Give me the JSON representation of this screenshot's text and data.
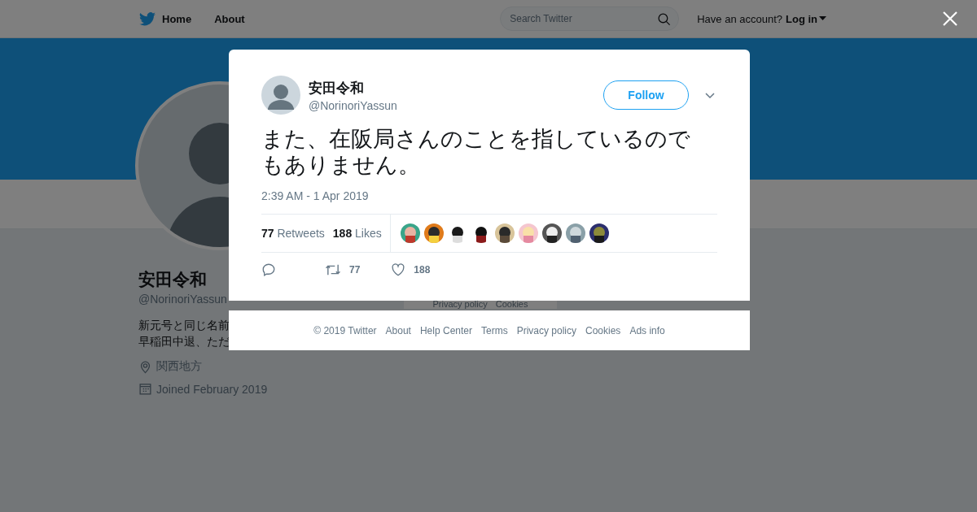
{
  "header": {
    "nav": [
      "Home",
      "About"
    ],
    "search": {
      "placeholder": "Search Twitter"
    },
    "account_prompt": "Have an account?",
    "login": "Log in"
  },
  "profile": {
    "name": "安田令和",
    "handle": "@NorinoriYassun",
    "bio_lines": [
      "新元号と同じ名前",
      "早稲田中退、ただ"
    ],
    "location": "関西地方",
    "joined": "Joined February 2019",
    "sidebar_links": [
      "Privacy policy",
      "Cookies"
    ]
  },
  "tweet": {
    "name": "安田令和",
    "handle": "@NorinoriYassun",
    "follow": "Follow",
    "text": "また、在阪局さんのことを指しているのでもありません。",
    "time": "2:39 AM - 1 Apr 2019",
    "retweets": "77",
    "retweets_label": "Retweets",
    "likes": "188",
    "likes_label": "Likes",
    "action_retweets": "77",
    "action_likes": "188"
  },
  "footer": [
    "© 2019 Twitter",
    "About",
    "Help Center",
    "Terms",
    "Privacy policy",
    "Cookies",
    "Ads info"
  ]
}
